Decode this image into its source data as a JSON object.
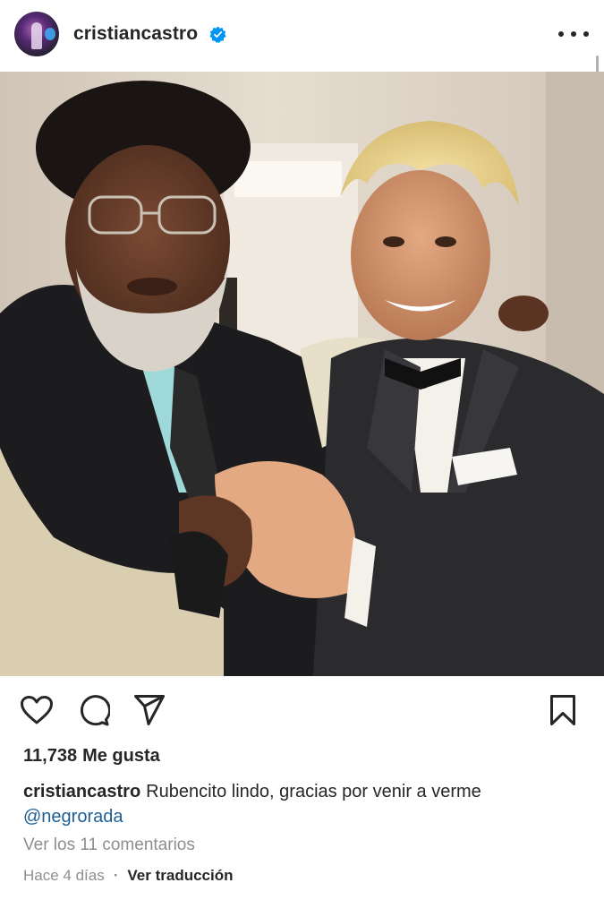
{
  "header": {
    "username": "cristiancastro",
    "verified": true,
    "avatar_icon": "profile-avatar",
    "more_icon": "more-options-icon"
  },
  "post": {
    "photo_description_icon": "post-photo"
  },
  "actions": {
    "like_icon": "heart-icon",
    "comment_icon": "comment-icon",
    "share_icon": "send-icon",
    "save_icon": "bookmark-icon"
  },
  "likes": {
    "count": "11,738",
    "label": "Me gusta"
  },
  "caption": {
    "user": "cristiancastro",
    "text": "Rubencito lindo, gracias por venir a verme",
    "mention": "@negrorada"
  },
  "comments": {
    "label": "Ver los 11 comentarios"
  },
  "meta": {
    "time": "Hace 4 días",
    "separator": "·",
    "translate": "Ver traducción"
  },
  "colors": {
    "text": "#262626",
    "secondary": "#8e8e8e",
    "link": "#1f5f94",
    "verified": "#0095f6"
  }
}
